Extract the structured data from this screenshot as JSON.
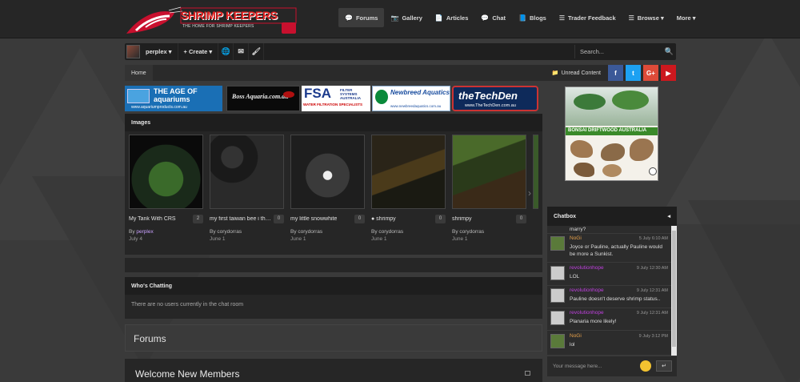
{
  "logo": {
    "brand": "SHRIMP KEEPERS",
    "tagline": "THE HOME FOR SHRIMP KEEPERS"
  },
  "nav": [
    {
      "label": "Forums",
      "icon": "comments-icon",
      "glyph": "💬",
      "active": true
    },
    {
      "label": "Gallery",
      "icon": "camera-icon",
      "glyph": "📷"
    },
    {
      "label": "Articles",
      "icon": "document-icon",
      "glyph": "📄"
    },
    {
      "label": "Chat",
      "icon": "chat-icon",
      "glyph": "💬"
    },
    {
      "label": "Blogs",
      "icon": "book-icon",
      "glyph": "📘"
    },
    {
      "label": "Trader Feedback",
      "icon": "list-icon",
      "glyph": "☰"
    },
    {
      "label": "Browse ▾",
      "icon": "list-icon",
      "glyph": "☰"
    },
    {
      "label": "More ▾",
      "icon": "",
      "glyph": ""
    }
  ],
  "userbar": {
    "username": "perplex ▾",
    "create": "+ Create ▾",
    "search_placeholder": "Search..."
  },
  "breadcrumb": {
    "home": "Home",
    "unread": "Unread Content"
  },
  "social": [
    {
      "name": "facebook-icon",
      "glyph": "f",
      "color": "#3b5998"
    },
    {
      "name": "twitter-icon",
      "glyph": "t",
      "color": "#1da1f2"
    },
    {
      "name": "google-plus-icon",
      "glyph": "G+",
      "color": "#dd4b39"
    },
    {
      "name": "youtube-icon",
      "glyph": "▶",
      "color": "#cc181e"
    }
  ],
  "ads": {
    "aquarium": "THE AGE OF aquariums",
    "aquarium_sub": "www.aquariumproducts.com.au",
    "boss": "Boss Aquaria.com.au",
    "fsa": "FSA",
    "fsa_side": "FILTER SYSTEMS AUSTRALIA",
    "fsa_sub": "WATER FILTRATION SPECIALISTS",
    "newbreed": "Newbreed Aquatics",
    "newbreed_sub": "www.newbreedaquatics.com.au",
    "techden": "theTechDen",
    "techden_sub": "www.TheTechDen.com.au"
  },
  "images_panel": {
    "title": "Images",
    "items": [
      {
        "title": "My Tank With CRS",
        "count": "2",
        "by": "By ",
        "user": "perplex",
        "date": "July 4"
      },
      {
        "title": "my first taiwan bee i think",
        "count": "0",
        "by": "By corydorras",
        "user": "",
        "date": "June 1"
      },
      {
        "title": "my little snowwhite",
        "count": "0",
        "by": "By corydorras",
        "user": "",
        "date": "June 1"
      },
      {
        "title": "● shrimpy",
        "count": "0",
        "by": "By corydorras",
        "user": "",
        "date": "June 1"
      },
      {
        "title": "shrimpy",
        "count": "0",
        "by": "By corydorras",
        "user": "",
        "date": "June 1"
      }
    ]
  },
  "whos_chatting": {
    "title": "Who's Chatting",
    "text": "There are no users currently in the chat room"
  },
  "forums_title": "Forums",
  "welcome_title": "Welcome New Members",
  "bonsai_ad": "BONSAI DRIFTWOOD AUSTRALIA",
  "chatbox": {
    "title": "Chatbox",
    "toggle": "◂",
    "input_placeholder": "Your message here...",
    "send": "↵",
    "messages": [
      {
        "name": "",
        "time": "",
        "text": "marry?",
        "color": "#e8a24a"
      },
      {
        "name": "NoGi",
        "time": "5 July 6:10 AM",
        "text": "Joyce or Pauline, actually Pauline would be more a Sunkist.",
        "color": "#e8a24a"
      },
      {
        "name": "revolutionhope",
        "time": "9 July 12:30 AM",
        "text": "LOL",
        "color": "#c040e0"
      },
      {
        "name": "revolutionhope",
        "time": "9 July 12:31 AM",
        "text": "Pauline doesn't deserve shrimp status..",
        "color": "#c040e0"
      },
      {
        "name": "revolutionhope",
        "time": "9 July 12:31 AM",
        "text": "Planaria more likely!",
        "color": "#c040e0"
      },
      {
        "name": "NoGi",
        "time": "9 July 3:12 PM",
        "text": "lol",
        "color": "#e8a24a"
      }
    ]
  }
}
